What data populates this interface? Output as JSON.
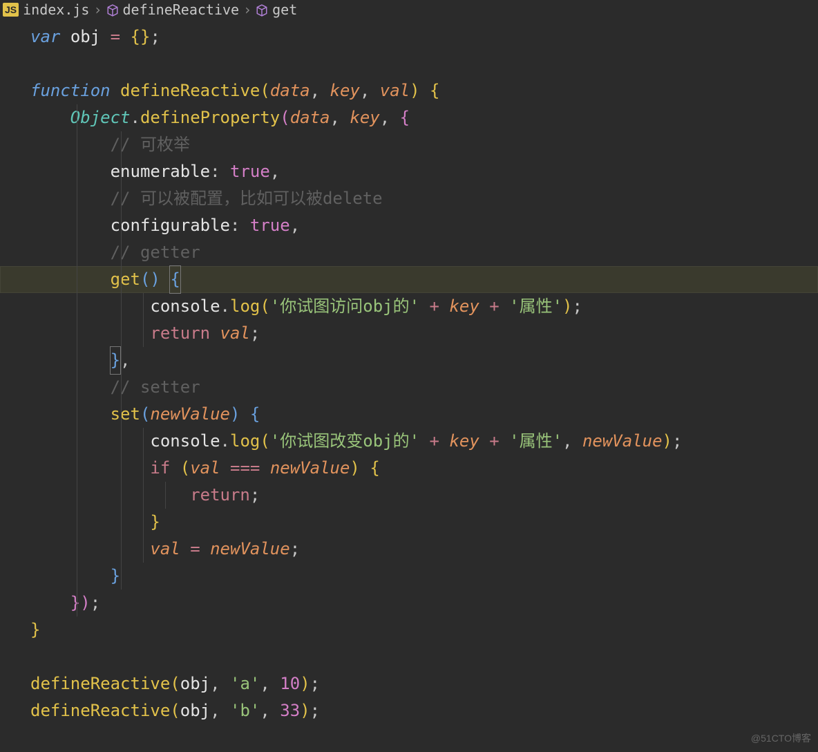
{
  "breadcrumb": {
    "file": "index.js",
    "sym1": "defineReactive",
    "sym2": "get"
  },
  "code": {
    "var": "var",
    "obj_decl": "obj",
    "eq": "=",
    "empty_obj_open": "{",
    "empty_obj_close": "}",
    "semi": ";",
    "function": "function",
    "defineReactive": "defineReactive",
    "p_data": "data",
    "p_key": "key",
    "p_val": "val",
    "Object": "Object",
    "defineProperty": "defineProperty",
    "cmt_enum": "// 可枚举",
    "enumerable": "enumerable",
    "true": "true",
    "cmt_config": "// 可以被配置，比如可以被delete",
    "configurable": "configurable",
    "cmt_getter": "// getter",
    "get": "get",
    "console": "console",
    "log": "log",
    "str_access": "'你试图访问obj的'",
    "plus": "+",
    "str_prop": "'属性'",
    "return": "return",
    "cmt_setter": "// setter",
    "set": "set",
    "newValue": "newValue",
    "str_change": "'你试图改变obj的'",
    "if": "if",
    "triple_eq": "===",
    "str_a": "'a'",
    "num_10": "10",
    "str_b": "'b'",
    "num_33": "33",
    "comma": ","
  },
  "watermark": "@51CTO博客"
}
